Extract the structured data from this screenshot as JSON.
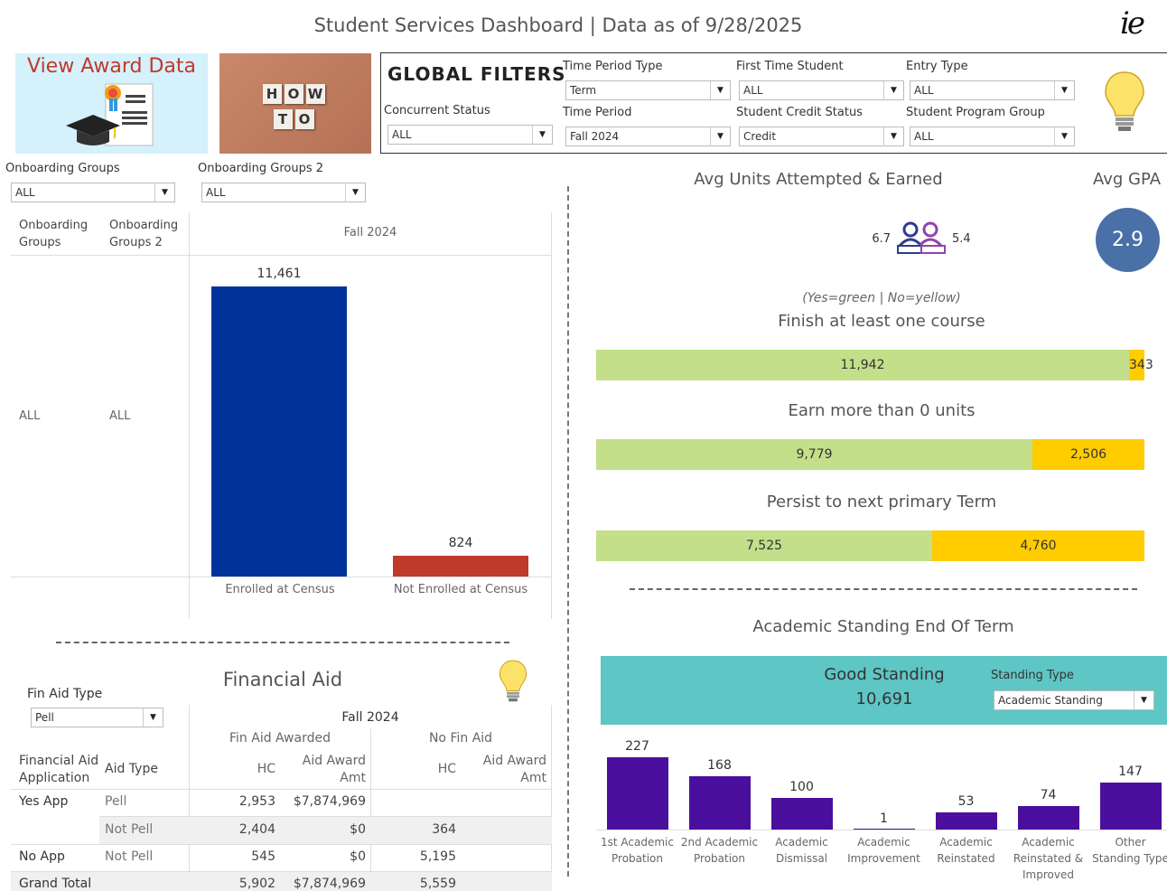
{
  "header": {
    "title": "Student Services Dashboard | Data as of 9/28/2025",
    "logo_text": "ie"
  },
  "tiles": {
    "award": "View Award Data",
    "how_to": [
      "H",
      "O",
      "W",
      "T",
      "O"
    ]
  },
  "global_filters": {
    "title": "GLOBAL FILTERS",
    "filters": [
      {
        "label": "Time Period Type",
        "value": "Term"
      },
      {
        "label": "First Time Student",
        "value": "ALL"
      },
      {
        "label": "Entry Type",
        "value": "ALL"
      },
      {
        "label": "Concurrent Status",
        "value": "ALL"
      },
      {
        "label": "Time Period",
        "value": "Fall 2024"
      },
      {
        "label": "Student Credit Status",
        "value": "Credit"
      },
      {
        "label": "Student Program Group",
        "value": "ALL"
      }
    ]
  },
  "onboarding": {
    "filters": [
      {
        "label": "Onboarding Groups",
        "value": "ALL"
      },
      {
        "label": "Onboarding Groups 2",
        "value": "ALL"
      }
    ],
    "col1": "Onboarding Groups",
    "col2": "Onboarding Groups 2",
    "period": "Fall 2024",
    "row1": "ALL",
    "row2": "ALL"
  },
  "enroll_chart": {
    "chart_data": {
      "type": "bar",
      "categories": [
        "Enrolled at Census",
        "Not Enrolled at Census"
      ],
      "values": [
        11461,
        824
      ],
      "value_labels": [
        "11,461",
        "824"
      ],
      "colors": [
        "#003399",
        "#c0392b"
      ]
    }
  },
  "units": {
    "title": "Avg Units Attempted & Earned",
    "attempted": "6.7",
    "earned": "5.4"
  },
  "gpa": {
    "title": "Avg GPA",
    "value": "2.9"
  },
  "legend_note": "(Yes=green | No=yellow)",
  "completion": {
    "chart_data": [
      {
        "type": "bar",
        "title": "Finish at least one course",
        "yes": 11942,
        "no": 343,
        "yes_label": "11,942",
        "no_label": "343"
      },
      {
        "type": "bar",
        "title": "Earn more than 0 units",
        "yes": 9779,
        "no": 2506,
        "yes_label": "9,779",
        "no_label": "2,506"
      },
      {
        "type": "bar",
        "title": "Persist to next primary Term",
        "yes": 7525,
        "no": 4760,
        "yes_label": "7,525",
        "no_label": "4,760"
      }
    ],
    "colors": {
      "yes": "#c3df8a",
      "no": "#ffcc00"
    }
  },
  "standing": {
    "title": "Academic Standing End Of Term",
    "good_label": "Good Standing",
    "good_value": "10,691",
    "type_label": "Standing Type",
    "type_value": "Academic Standing",
    "chart_data": {
      "type": "bar",
      "categories": [
        "1st Academic Probation",
        "2nd Academic Probation",
        "Academic Dismissal",
        "Academic Improvement",
        "Academic Reinstated",
        "Academic Reinstated & Improved",
        "Other Standing Type"
      ],
      "values": [
        227,
        168,
        100,
        1,
        53,
        74,
        147
      ],
      "color": "#4b0f9e"
    }
  },
  "fin_aid": {
    "title": "Financial Aid",
    "filter_label": "Fin Aid Type",
    "filter_value": "Pell",
    "period": "Fall 2024",
    "groups": [
      "Fin Aid Awarded",
      "No Fin Aid"
    ],
    "headers": {
      "app": "Financial Aid Application",
      "type": "Aid Type",
      "hc": "HC",
      "amt": "Aid Award Amt"
    },
    "rows": [
      {
        "app": "Yes App",
        "type": "Pell",
        "hc1": "2,953",
        "amt1": "$7,874,969",
        "hc2": "",
        "amt2": ""
      },
      {
        "app": "",
        "type": "Not Pell",
        "hc1": "2,404",
        "amt1": "$0",
        "hc2": "364",
        "amt2": ""
      },
      {
        "app": "No App",
        "type": "Not Pell",
        "hc1": "545",
        "amt1": "$0",
        "hc2": "5,195",
        "amt2": ""
      },
      {
        "app": "Grand Total",
        "type": "",
        "hc1": "5,902",
        "amt1": "$7,874,969",
        "hc2": "5,559",
        "amt2": ""
      }
    ]
  }
}
